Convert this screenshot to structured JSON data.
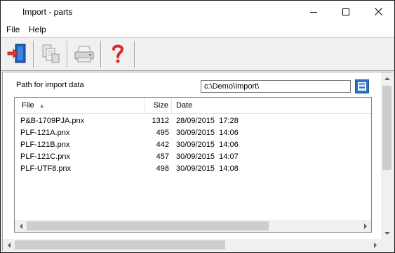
{
  "window": {
    "title": "Import - parts"
  },
  "menu": {
    "items": [
      "File",
      "Help"
    ]
  },
  "toolbar": {
    "buttons": [
      {
        "icon": "import-door-icon"
      },
      {
        "icon": "copy-files-icon"
      },
      {
        "icon": "printer-icon"
      },
      {
        "icon": "help-question-icon"
      }
    ]
  },
  "path": {
    "label": "Path for import data",
    "value": "c:\\Demo\\Import\\"
  },
  "file_list": {
    "columns": {
      "name": "File",
      "size": "Size",
      "date": "Date"
    },
    "sort_indicator": "▲",
    "rows": [
      {
        "name": "P&B-1709PJA.pnx",
        "size": "1312",
        "date": "28/09/2015  17:28"
      },
      {
        "name": "PLF-121A.pnx",
        "size": "495",
        "date": "30/09/2015  14:06"
      },
      {
        "name": "PLF-121B.pnx",
        "size": "442",
        "date": "30/09/2015  14:06"
      },
      {
        "name": "PLF-121C.pnx",
        "size": "457",
        "date": "30/09/2015  14:07"
      },
      {
        "name": "PLF-UTF8.pnx",
        "size": "498",
        "date": "30/09/2015  14:08"
      }
    ]
  },
  "colors": {
    "accent": "#2d6fc2",
    "border": "#a0a0a0"
  }
}
